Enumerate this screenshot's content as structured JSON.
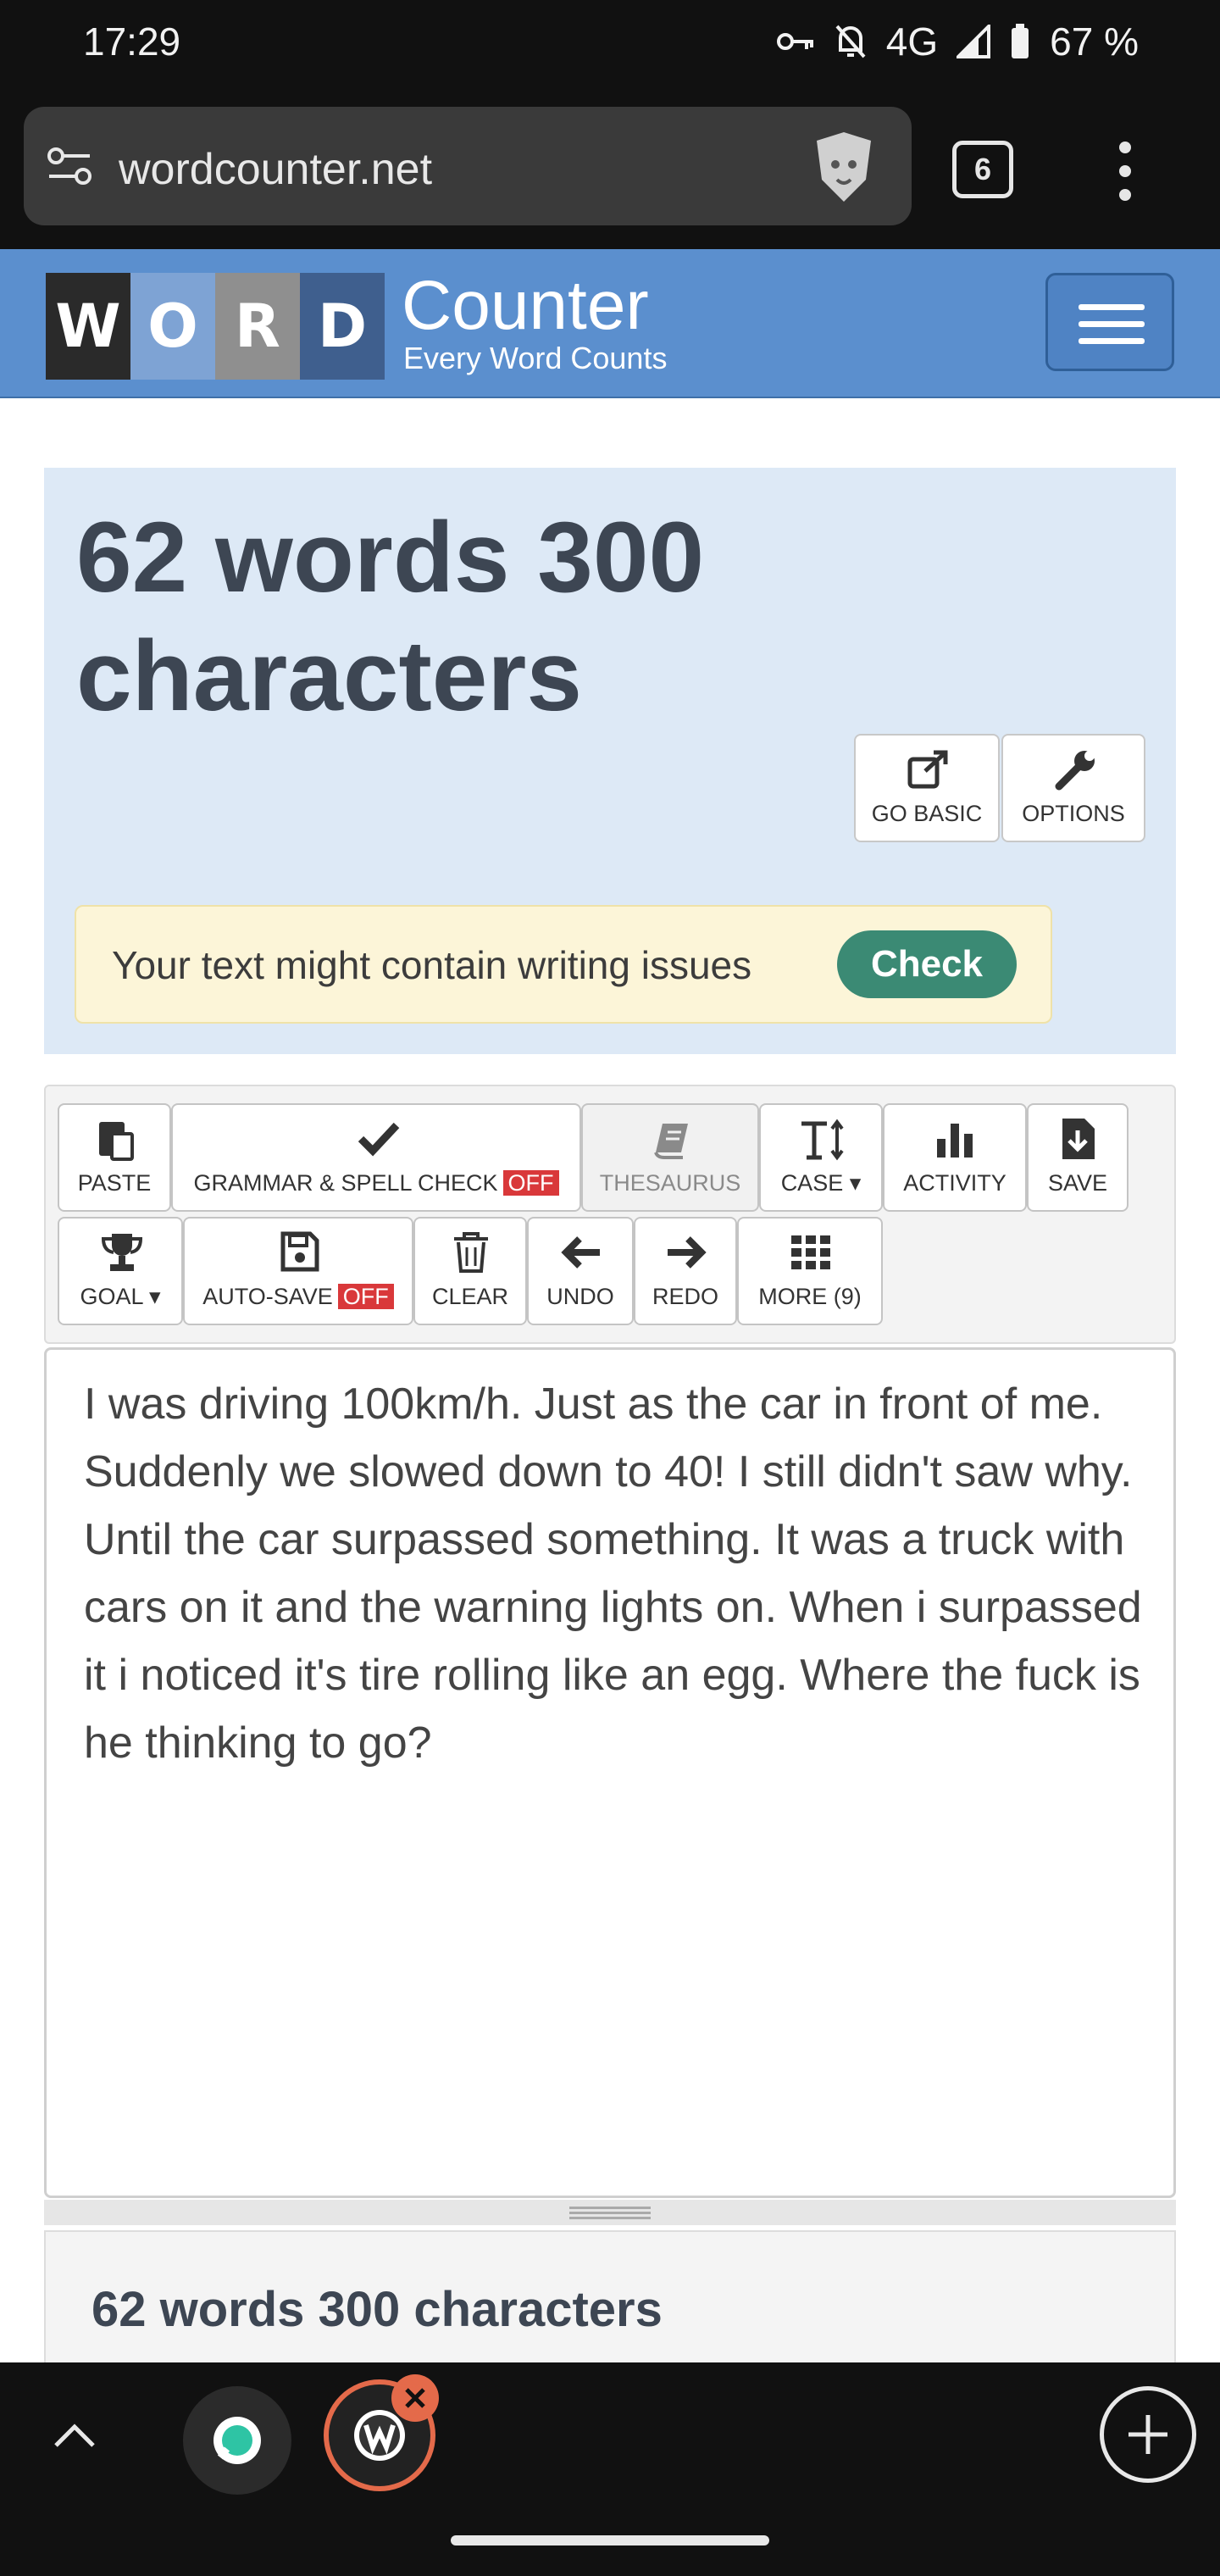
{
  "status_bar": {
    "time": "17:29",
    "network": "4G",
    "battery": "67 %"
  },
  "browser": {
    "url": "wordcounter.net",
    "tab_count": "6"
  },
  "site": {
    "logo_letters": [
      "W",
      "O",
      "R",
      "D"
    ],
    "logo_word": "Counter",
    "tagline": "Every Word Counts"
  },
  "summary": {
    "title": "62 words 300 characters",
    "go_basic_label": "GO BASIC",
    "options_label": "OPTIONS",
    "alert_text": "Your text might contain writing issues",
    "check_label": "Check"
  },
  "toolbar": {
    "paste": "PASTE",
    "grammar": "GRAMMAR & SPELL CHECK",
    "grammar_state": "OFF",
    "thesaurus": "THESAURUS",
    "case": "CASE",
    "activity": "ACTIVITY",
    "save": "SAVE",
    "goal": "GOAL",
    "autosave": "AUTO-SAVE",
    "autosave_state": "OFF",
    "clear": "CLEAR",
    "undo": "UNDO",
    "redo": "REDO",
    "more": "MORE (9)"
  },
  "editor": {
    "text": "I was driving 100km/h. Just as the car in front of me. Suddenly we slowed down to 40! I still didn't saw why. Until the car surpassed something. It was a truck with cars on it and the warning lights on. When i surpassed it i noticed it's tire rolling like an egg. Where the fuck is he thinking to go?"
  },
  "bottom": {
    "title": "62 words 300 characters"
  },
  "colors": {
    "header": "#5b8fce",
    "panel": "#dde9f6",
    "check": "#3b8a74",
    "off_badge": "#d9383a"
  }
}
